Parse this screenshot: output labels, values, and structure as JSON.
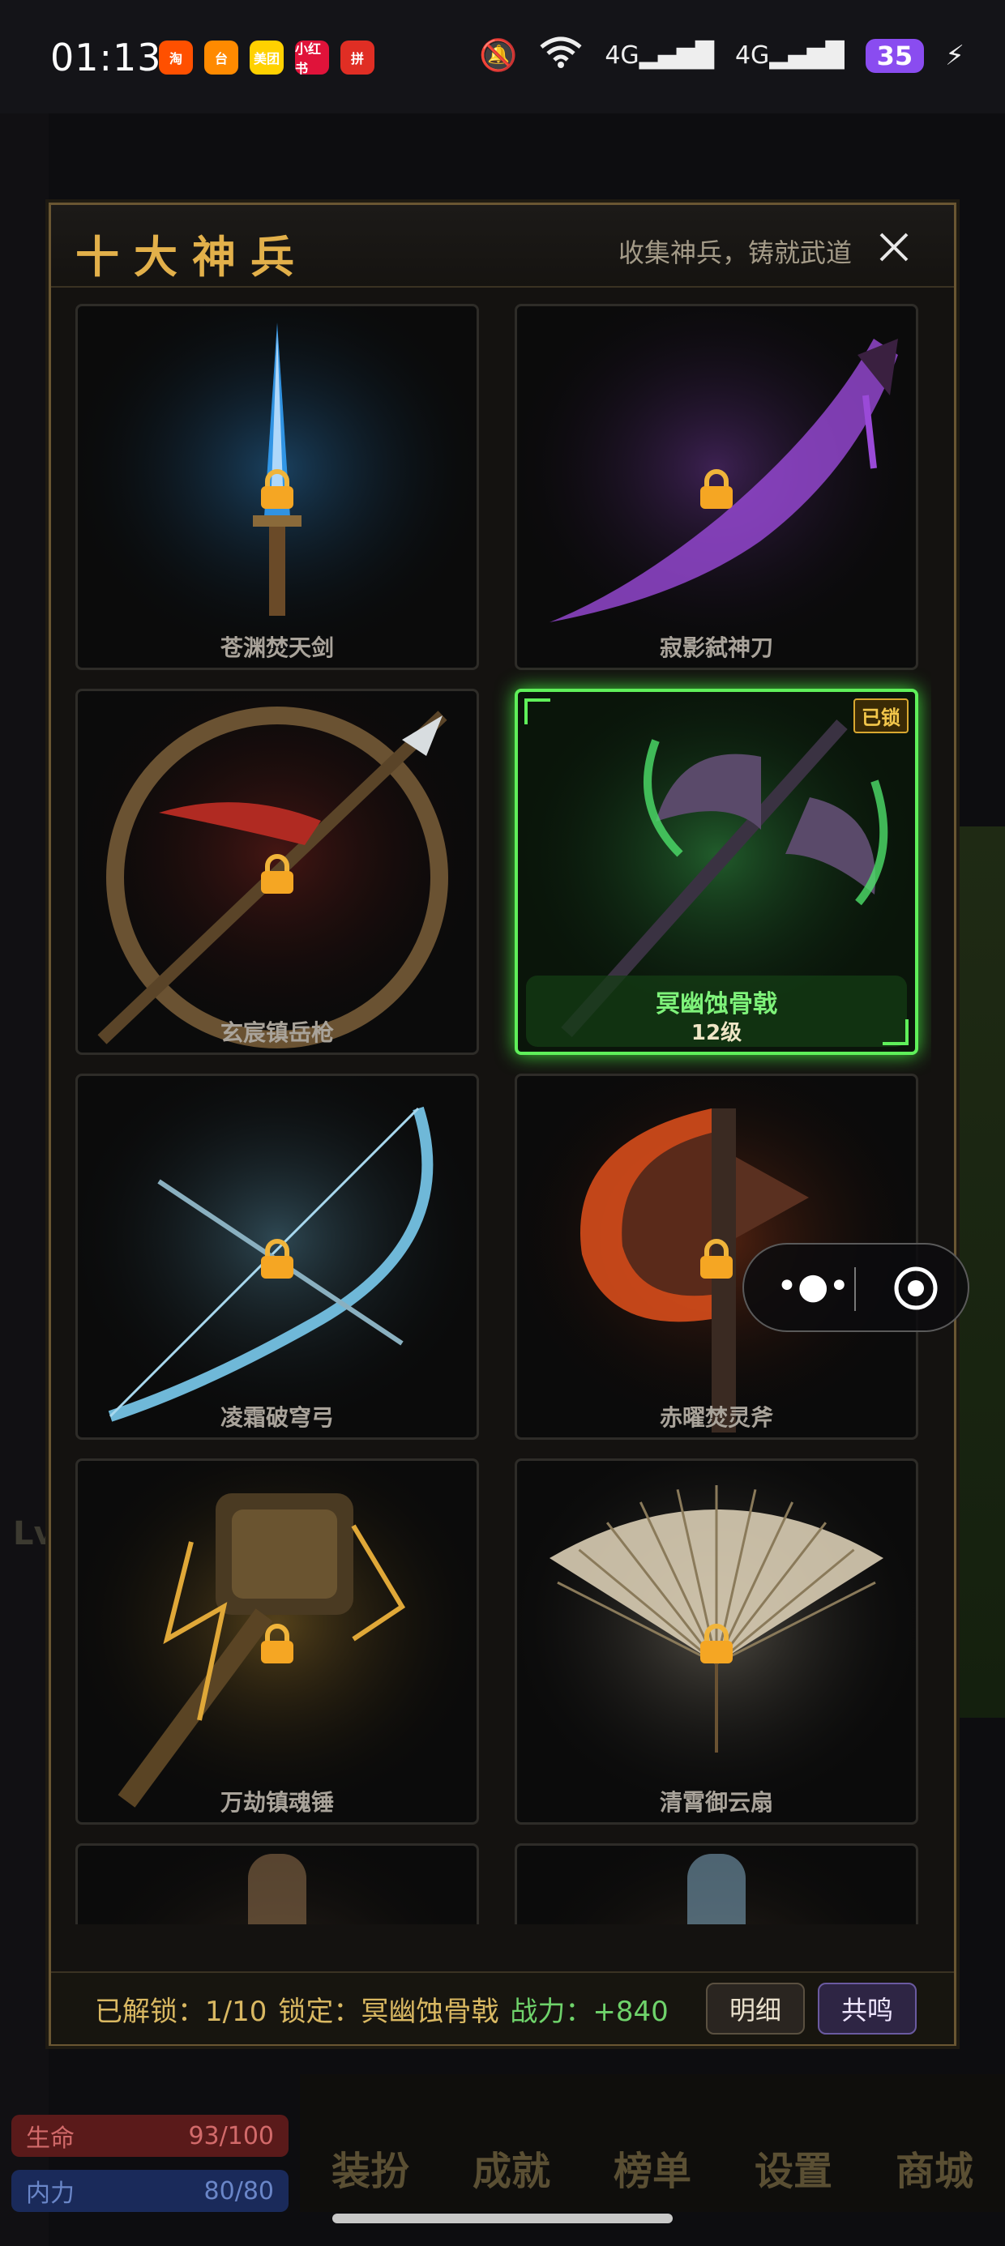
{
  "status_bar": {
    "time": "01:13",
    "apps": [
      {
        "name": "taobao",
        "glyph": "淘",
        "color": "#ff5000"
      },
      {
        "name": "app-orange",
        "glyph": "台",
        "color": "#ff8a00"
      },
      {
        "name": "meituan",
        "glyph": "美团",
        "color": "#ffd100"
      },
      {
        "name": "xiaohongshu",
        "glyph": "小红书",
        "color": "#e0133a"
      },
      {
        "name": "pinduoduo",
        "glyph": "拼",
        "color": "#e02e24"
      }
    ],
    "network": "4G",
    "battery": "35"
  },
  "modal": {
    "title": "十大神兵",
    "subtitle": "收集神兵，铸就武道",
    "close_icon": "close-icon",
    "weapons": [
      {
        "name": "苍渊焚天剑",
        "locked": true,
        "type": "sword",
        "color": "#36a6ff"
      },
      {
        "name": "寂影弑神刀",
        "locked": true,
        "type": "blade",
        "color": "#9a4ad8"
      },
      {
        "name": "玄宸镇岳枪",
        "locked": true,
        "type": "spear",
        "color": "#b02a22"
      },
      {
        "name": "冥幽蚀骨戟",
        "locked": false,
        "selected": true,
        "level": "12级",
        "badge": "已锁",
        "type": "halberd",
        "color": "#4de06a"
      },
      {
        "name": "凌霜破穹弓",
        "locked": true,
        "type": "bow",
        "color": "#6fb8d8"
      },
      {
        "name": "赤曜焚灵斧",
        "locked": true,
        "type": "axe",
        "color": "#e0501c"
      },
      {
        "name": "万劫镇魂锤",
        "locked": true,
        "type": "hammer",
        "color": "#e0a838"
      },
      {
        "name": "清霄御云扇",
        "locked": true,
        "type": "fan",
        "color": "#d9cdb4"
      },
      {
        "name": "",
        "locked": true,
        "type": "partial",
        "color": "#8a6a4a"
      },
      {
        "name": "",
        "locked": true,
        "type": "partial",
        "color": "#7aa0b8"
      }
    ],
    "footer": {
      "unlocked_label": "已解锁：1/10",
      "lock_label": "锁定：冥幽蚀骨戟",
      "power_label": "战力：+840",
      "detail_button": "明细",
      "resonate_button": "共鸣"
    }
  },
  "background": {
    "bottom_nav": [
      "装扮",
      "成就",
      "榜单",
      "设置",
      "商城"
    ],
    "hp": {
      "label": "生命",
      "value": "93/100",
      "fraction": 0.93
    },
    "mp": {
      "label": "内力",
      "value": "80/80",
      "fraction": 1.0
    }
  }
}
